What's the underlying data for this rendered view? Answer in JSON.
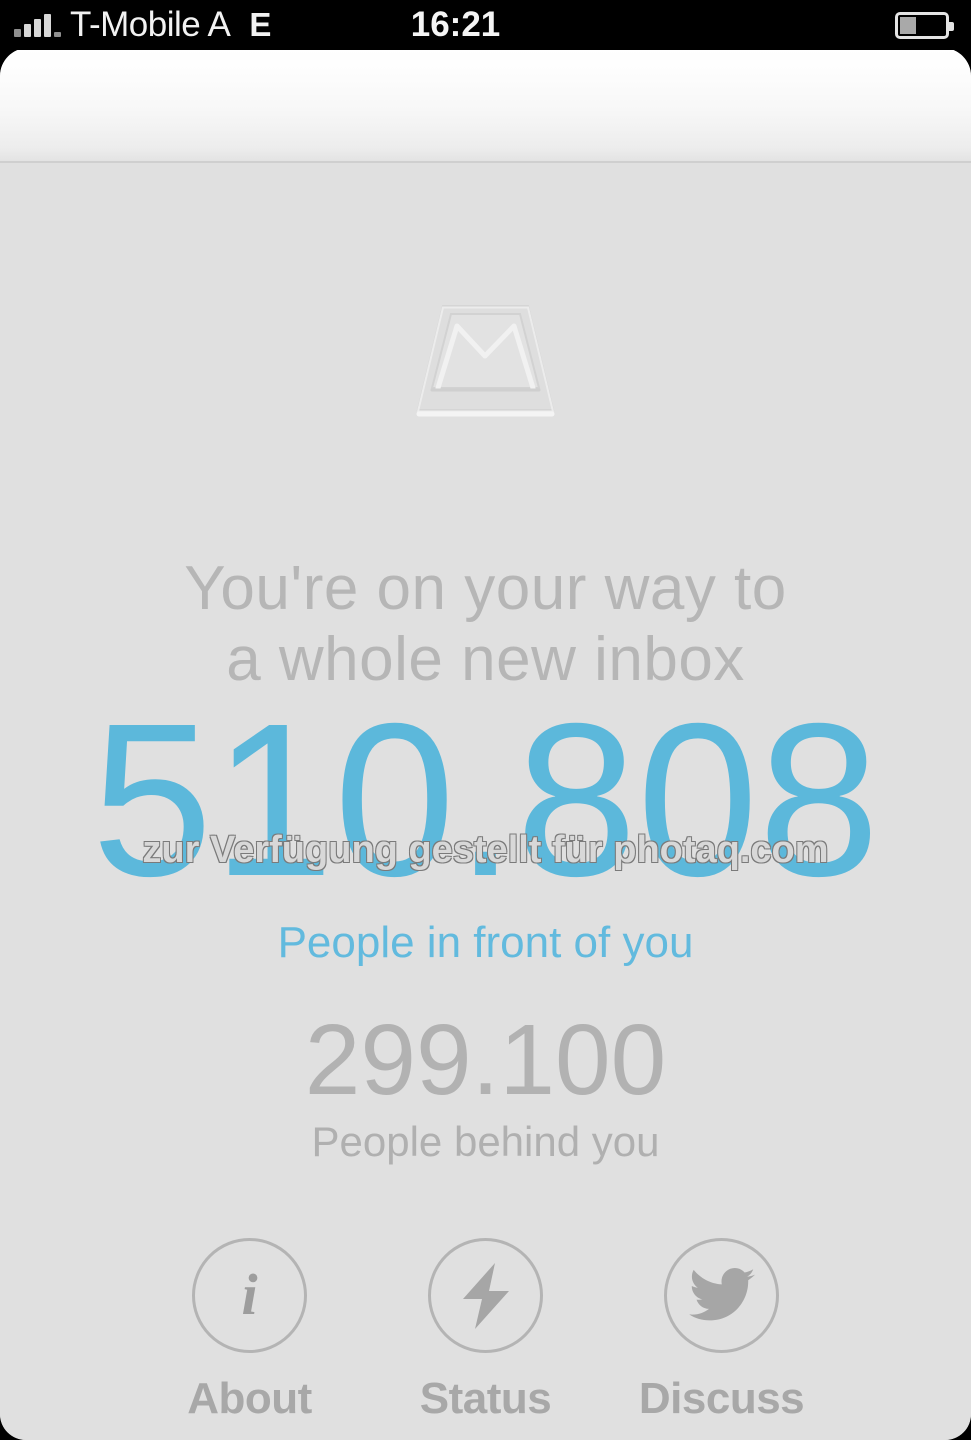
{
  "statusbar": {
    "carrier": "T-Mobile A",
    "network_type": "E",
    "time": "16:21",
    "signal_icon": "signal-bars-icon",
    "battery_icon": "battery-icon",
    "battery_level_percent": 33
  },
  "navbar": {
    "title": ""
  },
  "app": {
    "logo_icon": "mailbox-tray-logo-icon",
    "headline_line1": "You're on your way to",
    "headline_line2": "a whole new inbox",
    "queue_position": "510.808",
    "queue_position_label": "People in front of you",
    "behind_count": "299.100",
    "behind_count_label": "People behind you"
  },
  "watermark": {
    "text": "zur Verfügung gestellt für photaq.com"
  },
  "bottom_buttons": [
    {
      "label": "About",
      "icon": "info-icon"
    },
    {
      "label": "Status",
      "icon": "lightning-bolt-icon"
    },
    {
      "label": "Discuss",
      "icon": "twitter-bird-icon"
    }
  ],
  "colors": {
    "accent_blue": "#5cb8db",
    "background_grey": "#e0e0e0",
    "text_grey": "#b2b2b2",
    "navbar_white": "#ffffff",
    "statusbar_black": "#000000"
  }
}
